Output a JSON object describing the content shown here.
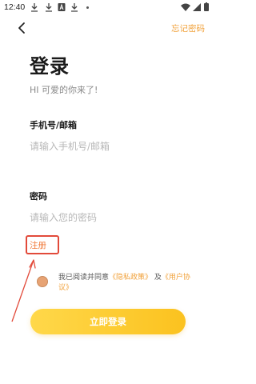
{
  "status_bar": {
    "time": "12:40",
    "icons": [
      "download-icon",
      "download-icon",
      "a-icon",
      "download-icon",
      "dot-icon",
      "wifi-icon",
      "signal-icon",
      "battery-icon"
    ]
  },
  "nav": {
    "back_icon": "chevron-left-icon",
    "forgot_password": "忘记密码"
  },
  "header": {
    "title": "登录",
    "subtitle": "HI 可爱的你来了!"
  },
  "form": {
    "account_label": "手机号/邮箱",
    "account_placeholder": "请输入手机号/邮箱",
    "account_value": "",
    "password_label": "密码",
    "password_placeholder": "请输入您的密码",
    "password_value": ""
  },
  "register": {
    "label": "注册"
  },
  "agreement": {
    "prefix": "我已阅读并同意",
    "privacy_link": "《隐私政策》",
    "and": "及",
    "user_link": "《用户协议》"
  },
  "actions": {
    "login_label": "立即登录"
  },
  "colors": {
    "accent": "#f1a23c",
    "button_gradient_start": "#ffd84a",
    "button_gradient_end": "#fbc21f",
    "annotation_red": "#e24a3a"
  }
}
